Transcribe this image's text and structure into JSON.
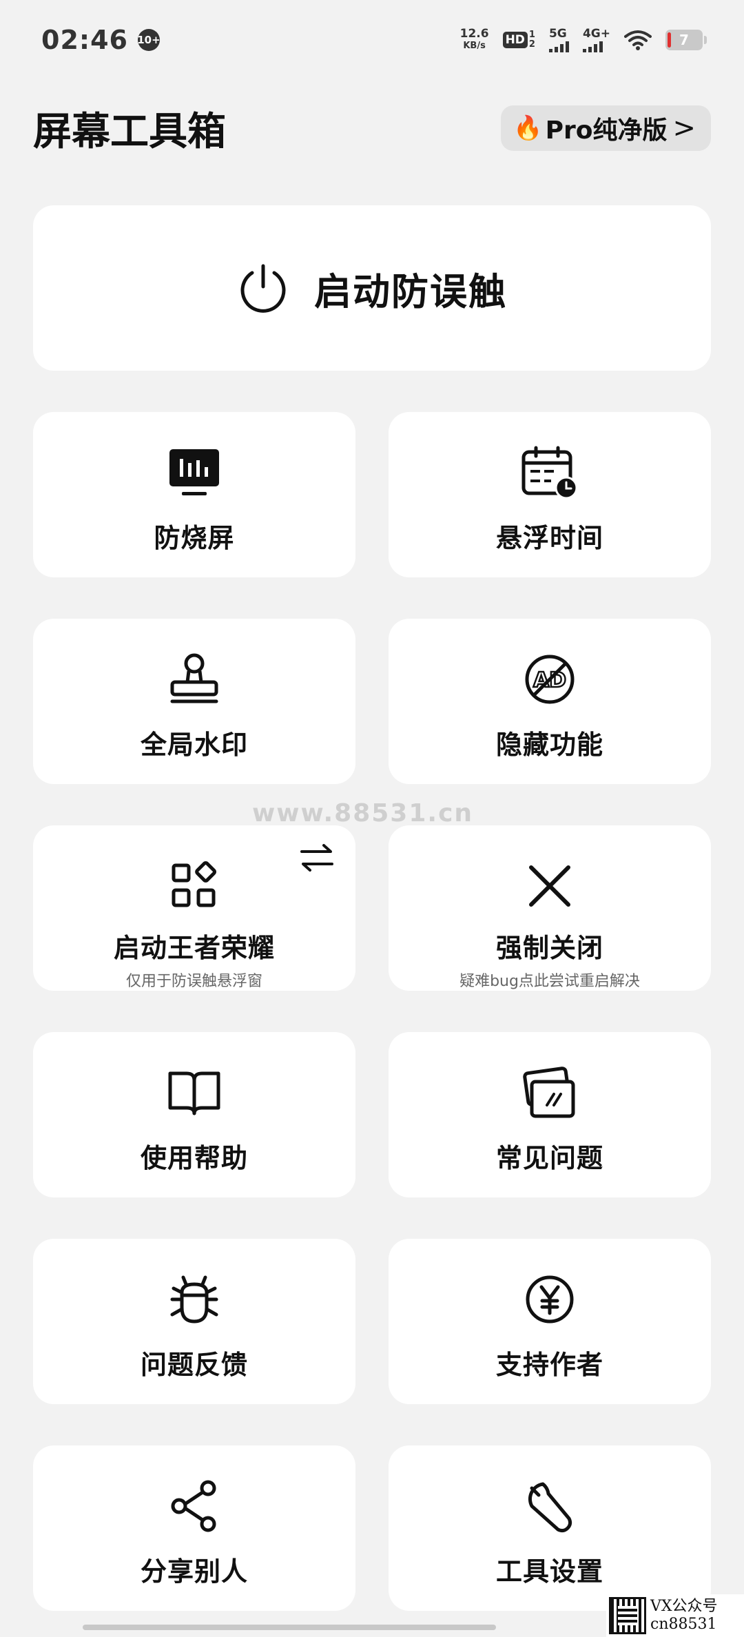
{
  "status_bar": {
    "time": "02:46",
    "badge": "10+",
    "speed_value": "12.6",
    "speed_unit": "KB/s",
    "hd": "HD",
    "hd_top": "1",
    "hd_bottom": "2",
    "net1": "5G",
    "net2": "4G+",
    "battery": "7"
  },
  "header": {
    "title": "屏幕工具箱",
    "pro_label": "Pro纯净版",
    "pro_icon": "🔥",
    "chevron": ">"
  },
  "main_button": {
    "label": "启动防误触",
    "icon": "power-icon"
  },
  "tiles": [
    {
      "label": "防烧屏",
      "icon": "monitor-bars-icon"
    },
    {
      "label": "悬浮时间",
      "icon": "calendar-clock-icon"
    },
    {
      "label": "全局水印",
      "icon": "stamp-icon"
    },
    {
      "label": "隐藏功能",
      "icon": "ad-block-icon"
    },
    {
      "label": "启动王者荣耀",
      "sub": "仅用于防误触悬浮窗",
      "icon": "apps-grid-icon"
    },
    {
      "label": "强制关闭",
      "sub": "疑难bug点此尝试重启解决",
      "icon": "close-icon"
    },
    {
      "label": "使用帮助",
      "icon": "book-icon"
    },
    {
      "label": "常见问题",
      "icon": "cards-icon"
    },
    {
      "label": "问题反馈",
      "icon": "bug-icon"
    },
    {
      "label": "支持作者",
      "icon": "yen-icon"
    },
    {
      "label": "分享别人",
      "icon": "share-icon"
    },
    {
      "label": "工具设置",
      "icon": "wrench-icon"
    }
  ],
  "overlay": {
    "watermark": "www.88531.cn",
    "corner_line1": "VX公众号",
    "corner_line2": "cn88531"
  },
  "colors": {
    "background": "#f2f2f2",
    "card": "#ffffff",
    "text": "#111111",
    "subtext": "#666666",
    "pro_button_bg": "#e2e2e2"
  }
}
